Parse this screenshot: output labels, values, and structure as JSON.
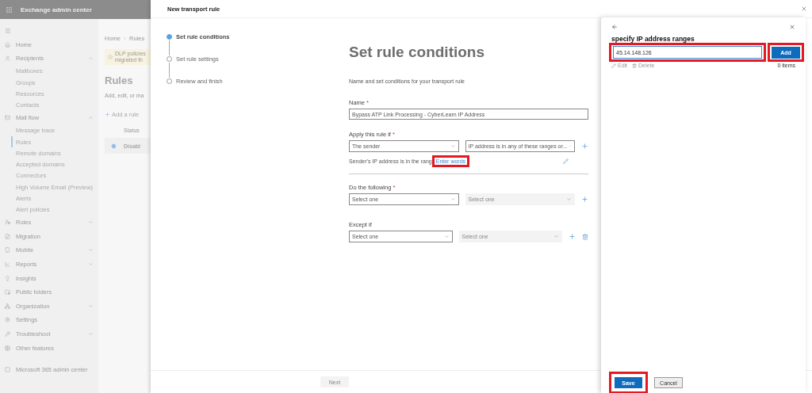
{
  "app": {
    "title": "Exchange admin center"
  },
  "sidebar": {
    "items": [
      {
        "label": "Home",
        "expandable": false,
        "expanded": false,
        "selected": false
      },
      {
        "label": "Recipients",
        "expandable": true,
        "expanded": true,
        "selected": false,
        "children": [
          {
            "label": "Mailboxes",
            "selected": false
          },
          {
            "label": "Groups",
            "selected": false
          },
          {
            "label": "Resources",
            "selected": false
          },
          {
            "label": "Contacts",
            "selected": false
          }
        ]
      },
      {
        "label": "Mail flow",
        "expandable": true,
        "expanded": true,
        "selected": false,
        "children": [
          {
            "label": "Message trace",
            "selected": false
          },
          {
            "label": "Rules",
            "selected": true
          },
          {
            "label": "Remote domains",
            "selected": false
          },
          {
            "label": "Accepted domains",
            "selected": false
          },
          {
            "label": "Connectors",
            "selected": false
          },
          {
            "label": "High Volume Email (Preview)",
            "selected": false
          },
          {
            "label": "Alerts",
            "selected": false
          },
          {
            "label": "Alert policies",
            "selected": false
          }
        ]
      },
      {
        "label": "Roles",
        "expandable": true,
        "expanded": false,
        "selected": false
      },
      {
        "label": "Migration",
        "expandable": false,
        "expanded": false,
        "selected": false
      },
      {
        "label": "Mobile",
        "expandable": true,
        "expanded": false,
        "selected": false
      },
      {
        "label": "Reports",
        "expandable": true,
        "expanded": false,
        "selected": false
      },
      {
        "label": "Insights",
        "expandable": false,
        "expanded": false,
        "selected": false
      },
      {
        "label": "Public folders",
        "expandable": false,
        "expanded": false,
        "selected": false
      },
      {
        "label": "Organization",
        "expandable": true,
        "expanded": false,
        "selected": false
      },
      {
        "label": "Settings",
        "expandable": false,
        "expanded": false,
        "selected": false
      },
      {
        "label": "Troubleshoot",
        "expandable": true,
        "expanded": false,
        "selected": false
      },
      {
        "label": "Other features",
        "expandable": false,
        "expanded": false,
        "selected": false
      }
    ],
    "footer_link": "Microsoft 365 admin center"
  },
  "page": {
    "breadcrumb": [
      "Home",
      "Rules"
    ],
    "notice": [
      "DLP policies",
      "migrated th"
    ],
    "title": "Rules",
    "subtitle": "Add, edit, or ma",
    "add_button": "Add a rule",
    "column": "Status",
    "row_status": "Disabl"
  },
  "transport_rule": {
    "title": "New transport rule",
    "steps": [
      {
        "label": "Set rule conditions",
        "selected": true
      },
      {
        "label": "Set rule settings",
        "selected": false
      },
      {
        "label": "Review and finish",
        "selected": false
      }
    ],
    "heading": "Set rule conditions",
    "intro": "Name and set conditions for your transport rule",
    "name": {
      "label": "Name",
      "asterisk": "*",
      "value": "Bypass ATP Link Processing - CyberLearn IP Address"
    },
    "sections": [
      {
        "label": "Apply this rule if",
        "asterisk": "*",
        "deletable": false,
        "selects": [
          {
            "value": "The sender",
            "disabled": false
          },
          {
            "value": "IP address is in any of these ranges or...",
            "disabled": false
          }
        ],
        "summary": "Sender's IP address is in the rang",
        "link": {
          "label": "Enter words",
          "highlighted": true
        }
      },
      {
        "label": "Do the following",
        "asterisk": "*",
        "deletable": false,
        "selects": [
          {
            "placeholder": "Select one",
            "disabled": false
          },
          {
            "placeholder": "Select one",
            "disabled": true
          }
        ]
      },
      {
        "label": "Except if",
        "deletable": true,
        "selects": [
          {
            "placeholder": "Select one",
            "disabled": false
          },
          {
            "placeholder": "Select one",
            "disabled": true
          }
        ]
      }
    ],
    "next_button": {
      "label": "Next",
      "disabled": true
    }
  },
  "ip_panel": {
    "title": "specify IP address ranges",
    "input": {
      "value": "45.14.148.126",
      "highlighted": true
    },
    "add_button": {
      "label": "Add",
      "highlighted": true
    },
    "actions": [
      {
        "label": "Edit",
        "disabled": true
      },
      {
        "label": "Delete",
        "disabled": true
      }
    ],
    "count": "0 items",
    "save_button": {
      "label": "Save",
      "highlighted": true
    },
    "cancel_button": {
      "label": "Cancel"
    }
  }
}
